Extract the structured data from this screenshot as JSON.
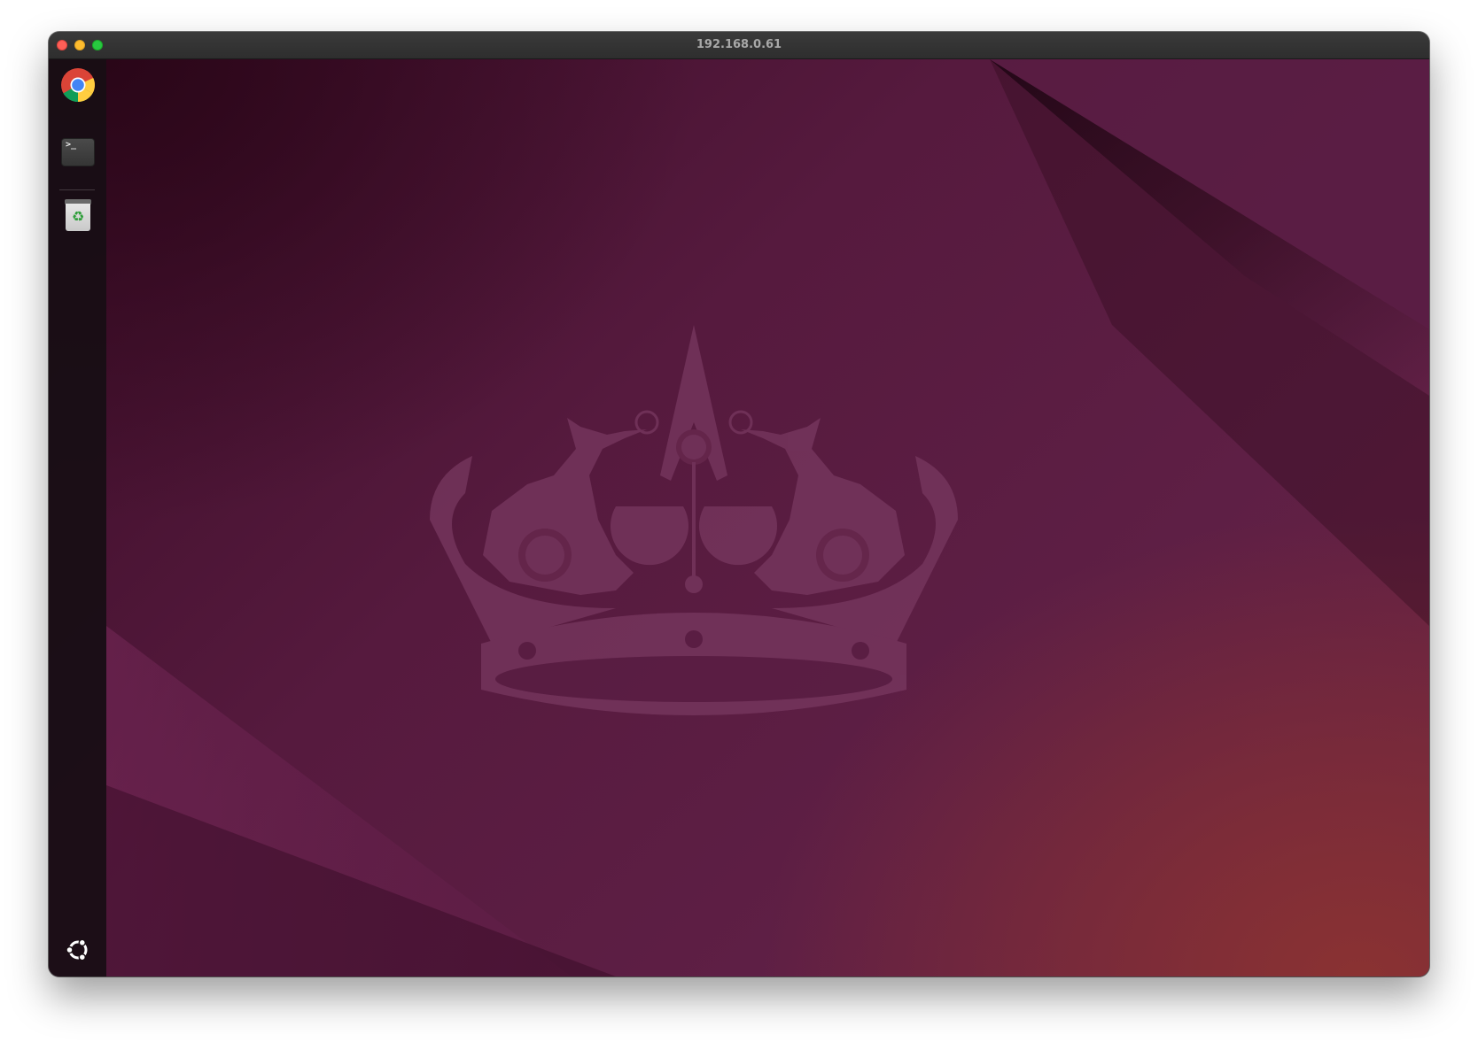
{
  "window": {
    "title": "192.168.0.61"
  },
  "dock": {
    "items": [
      {
        "name": "chrome",
        "icon": "chrome-icon"
      },
      {
        "name": "terminal",
        "icon": "terminal-icon",
        "glyph": ">_"
      },
      {
        "name": "trash",
        "icon": "trash-icon",
        "glyph": "♻"
      }
    ],
    "apps_button": {
      "icon": "ubuntu-logo-icon"
    }
  },
  "wallpaper": {
    "theme": "ubuntu-noble-numbat",
    "emblem": "crown-icon",
    "colors": {
      "base": "#561a3e",
      "dark_corner": "#2a0618",
      "warm_corner": "#8a3232",
      "emblem": "#7a3a60"
    }
  }
}
